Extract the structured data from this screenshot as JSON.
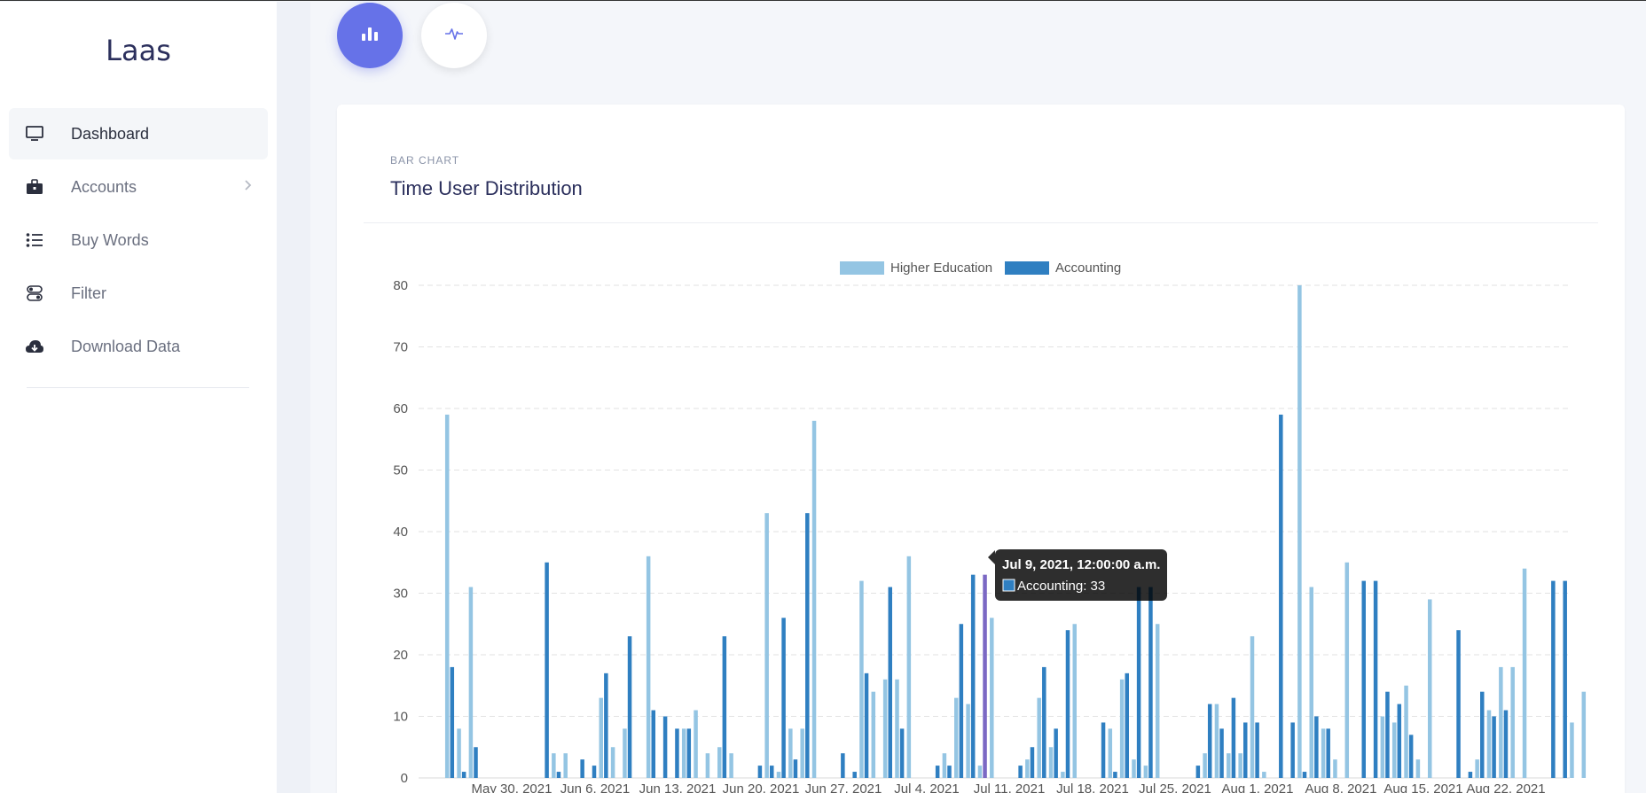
{
  "app": {
    "brand": "Laas"
  },
  "sidebar": {
    "items": [
      {
        "label": "Dashboard",
        "icon": "monitor-icon",
        "active": true
      },
      {
        "label": "Accounts",
        "icon": "briefcase-icon",
        "has_submenu": true
      },
      {
        "label": "Buy Words",
        "icon": "list-icon"
      },
      {
        "label": "Filter",
        "icon": "filter-icon"
      },
      {
        "label": "Download Data",
        "icon": "cloud-download-icon"
      }
    ]
  },
  "toolbar": {
    "buttons": [
      {
        "icon": "bar-chart-icon",
        "active": true
      },
      {
        "icon": "activity-icon",
        "active": false
      }
    ]
  },
  "card": {
    "kicker": "BAR CHART",
    "title": "Time User Distribution"
  },
  "colors": {
    "accent": "#6672e8",
    "higher_education": "#94c5e3",
    "accounting": "#2f7fc1",
    "hover": "#7b68c4"
  },
  "chart_data": {
    "type": "bar",
    "title": "",
    "xlabel": "",
    "ylabel": "",
    "ylim": [
      0,
      80
    ],
    "y_ticks": [
      0,
      10,
      20,
      30,
      40,
      50,
      60,
      70,
      80
    ],
    "grid": true,
    "legend_position": "top-center",
    "x_tick_labels": [
      "May 30, 2021",
      "Jun 6, 2021",
      "Jun 13, 2021",
      "Jun 20, 2021",
      "Jun 27, 2021",
      "Jul 4, 2021",
      "Jul 11, 2021",
      "Jul 18, 2021",
      "Jul 25, 2021",
      "Aug 1, 2021",
      "Aug 8, 2021",
      "Aug 15, 2021",
      "Aug 22, 2021"
    ],
    "series": [
      {
        "name": "Higher Education",
        "values": [
          59,
          8,
          31,
          0,
          0,
          0,
          0,
          0,
          0,
          4,
          4,
          0,
          0,
          13,
          5,
          8,
          0,
          36,
          0,
          0,
          8,
          11,
          4,
          5,
          4,
          0,
          0,
          43,
          1,
          8,
          8,
          58,
          0,
          0,
          0,
          32,
          14,
          16,
          16,
          36,
          0,
          0,
          4,
          13,
          12,
          2,
          26,
          0,
          0,
          3,
          13,
          5,
          1,
          25,
          0,
          0,
          8,
          16,
          3,
          2,
          25,
          0,
          0,
          0,
          4,
          12,
          4,
          4,
          23,
          1,
          0,
          0,
          80,
          31,
          8,
          3,
          35,
          0,
          0,
          10,
          9,
          15,
          3,
          29,
          0,
          0,
          0,
          3,
          11,
          18,
          18,
          34,
          0,
          0,
          0,
          9,
          14
        ]
      },
      {
        "name": "Accounting",
        "values": [
          18,
          1,
          5,
          0,
          0,
          0,
          0,
          0,
          35,
          1,
          0,
          3,
          2,
          17,
          0,
          23,
          0,
          11,
          10,
          8,
          8,
          0,
          0,
          23,
          0,
          0,
          2,
          2,
          26,
          3,
          43,
          0,
          0,
          4,
          1,
          17,
          0,
          31,
          8,
          0,
          0,
          2,
          2,
          25,
          33,
          33,
          0,
          0,
          2,
          5,
          18,
          8,
          24,
          0,
          0,
          9,
          1,
          17,
          31,
          31,
          0,
          0,
          0,
          2,
          12,
          8,
          13,
          9,
          9,
          0,
          59,
          9,
          1,
          10,
          8,
          0,
          0,
          32,
          32,
          14,
          12,
          7,
          0,
          0,
          0,
          24,
          1,
          14,
          10,
          11,
          0,
          0,
          0,
          32,
          32,
          0,
          0
        ]
      }
    ],
    "tooltip": {
      "date": "Jul 9, 2021, 12:00:00 a.m.",
      "series": "Accounting",
      "value": 33,
      "line": "Accounting: 33"
    }
  }
}
